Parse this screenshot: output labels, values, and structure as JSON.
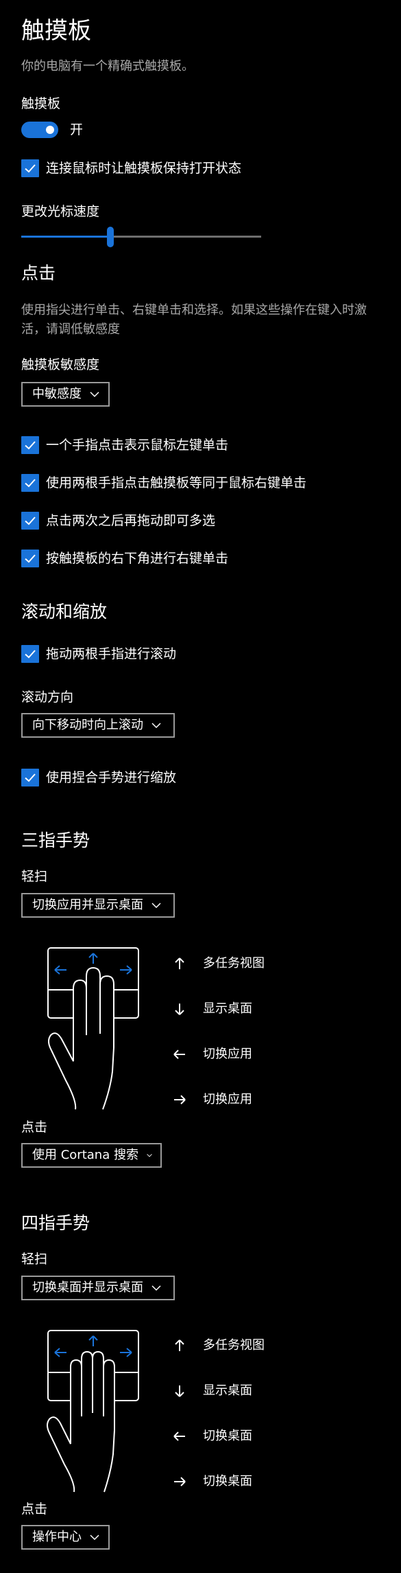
{
  "page": {
    "title": "触摸板",
    "subtitle": "你的电脑有一个精确式触摸板。"
  },
  "touchpad": {
    "label": "触摸板",
    "toggle_state": "开",
    "keep_on_with_mouse": "连接鼠标时让触摸板保持打开状态",
    "cursor_speed_label": "更改光标速度",
    "cursor_speed_value": 0.37
  },
  "taps": {
    "heading": "点击",
    "description": "使用指尖进行单击、右键单击和选择。如果这些操作在键入时激活，请调低敏感度",
    "sensitivity_label": "触摸板敏感度",
    "sensitivity_value": "中敏感度",
    "options": [
      "一个手指点击表示鼠标左键单击",
      "使用两根手指点击触摸板等同于鼠标右键单击",
      "点击两次之后再拖动即可多选",
      "按触摸板的右下角进行右键单击"
    ]
  },
  "scroll_zoom": {
    "heading": "滚动和缩放",
    "drag_two_fingers": "拖动两根手指进行滚动",
    "direction_label": "滚动方向",
    "direction_value": "向下移动时向上滚动",
    "pinch_zoom": "使用捏合手势进行缩放"
  },
  "three_finger": {
    "heading": "三指手势",
    "swipe_label": "轻扫",
    "swipe_value": "切换应用并显示桌面",
    "gestures": [
      {
        "icon": "arrow-up-icon",
        "text": "多任务视图"
      },
      {
        "icon": "arrow-down-icon",
        "text": "显示桌面"
      },
      {
        "icon": "arrow-left-icon",
        "text": "切换应用"
      },
      {
        "icon": "arrow-right-icon",
        "text": "切换应用"
      }
    ],
    "tap_label": "点击",
    "tap_value": "使用 Cortana 搜索"
  },
  "four_finger": {
    "heading": "四指手势",
    "swipe_label": "轻扫",
    "swipe_value": "切换桌面并显示桌面",
    "gestures": [
      {
        "icon": "arrow-up-icon",
        "text": "多任务视图"
      },
      {
        "icon": "arrow-down-icon",
        "text": "显示桌面"
      },
      {
        "icon": "arrow-left-icon",
        "text": "切换桌面"
      },
      {
        "icon": "arrow-right-icon",
        "text": "切换桌面"
      }
    ],
    "tap_label": "点击",
    "tap_value": "操作中心"
  },
  "colors": {
    "accent": "#1a73d9",
    "background": "#000000",
    "secondary_text": "#a8a8a8"
  }
}
